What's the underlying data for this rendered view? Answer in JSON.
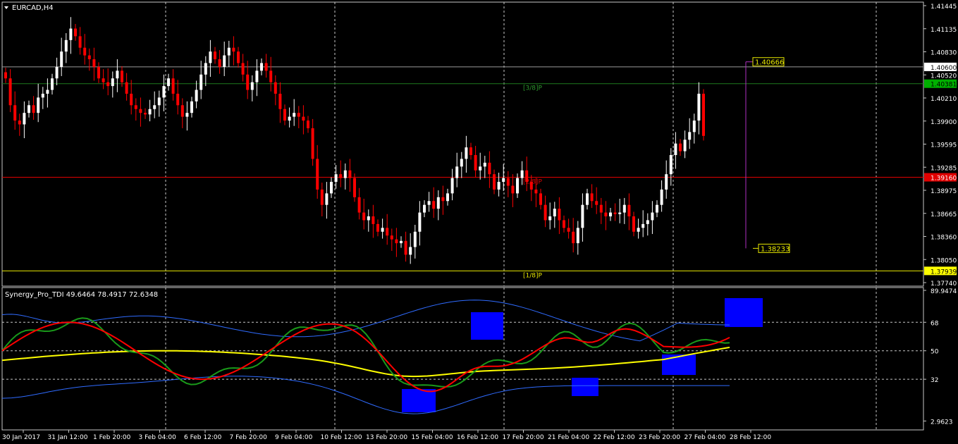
{
  "symbol": "EURCAD,H4",
  "indicator": "Synergy_Pro_TDI 49.6464 78.4917 72.6348",
  "price_axis": {
    "range": [
      1.3774,
      1.41445
    ],
    "ticks": [
      "1.41445",
      "1.41135",
      "1.40830",
      "1.40520",
      "1.40210",
      "1.39900",
      "1.39595",
      "1.39285",
      "1.38975",
      "1.38665",
      "1.38360",
      "1.38050",
      "1.37740"
    ]
  },
  "price_tags": [
    {
      "value": "1.40600",
      "bg": "#ffffff",
      "fg": "#000000"
    },
    {
      "value": "1.40381",
      "bg": "#00b000",
      "fg": "#000000"
    },
    {
      "value": "1.39160",
      "bg": "#e00000",
      "fg": "#ffffff"
    },
    {
      "value": "1.37939",
      "bg": "#ffff00",
      "fg": "#000000"
    }
  ],
  "horizontal_lines": [
    {
      "price": 1.406,
      "color": "#9a9a9a",
      "label": ""
    },
    {
      "price": 1.40381,
      "color": "#1e7a1e",
      "label": "[3/8]P",
      "label_color": "#2e9a2e"
    },
    {
      "price": 1.3916,
      "color": "#e00000",
      "label": "[2/8]P",
      "label_color": "#e00000"
    },
    {
      "price": 1.37939,
      "color": "#e8e800",
      "label": "[1/8]P",
      "label_color": "#e8e800"
    }
  ],
  "measure": {
    "top_label": "1.40666",
    "bottom_label": "1.38233",
    "top": 1.40666,
    "bottom": 1.38233,
    "color": "#b030c0"
  },
  "time_labels": [
    "30 Jan 2017",
    "31 Jan 12:00",
    "1 Feb 20:00",
    "3 Feb 04:00",
    "6 Feb 12:00",
    "7 Feb 20:00",
    "9 Feb 04:00",
    "10 Feb 12:00",
    "13 Feb 20:00",
    "15 Feb 04:00",
    "16 Feb 12:00",
    "17 Feb 20:00",
    "21 Feb 04:00",
    "22 Feb 12:00",
    "23 Feb 20:00",
    "27 Feb 04:00",
    "28 Feb 12:00"
  ],
  "indicator_axis": {
    "range": [
      0,
      89.9474
    ],
    "ticks": [
      "89.9474",
      "68",
      "50",
      "32",
      "2.9623"
    ],
    "levels": [
      68,
      50,
      32
    ]
  },
  "colors": {
    "bull": "#ffffff",
    "bear": "#ff0000",
    "rsi": "#ff0000",
    "signal": "#1a9a1a",
    "mid": "#ffff00",
    "bands": "#2f6bff",
    "box": "#0000ff",
    "grid": "#c8c8c8"
  },
  "chart_data": {
    "type": "candlestick",
    "closes": [
      1.4045,
      1.401,
      1.399,
      1.3985,
      1.4,
      1.401,
      1.4,
      1.402,
      1.4025,
      1.403,
      1.4045,
      1.406,
      1.408,
      1.4095,
      1.411,
      1.41,
      1.4085,
      1.4075,
      1.407,
      1.406,
      1.4045,
      1.404,
      1.4035,
      1.4045,
      1.4055,
      1.404,
      1.4025,
      1.401,
      1.4005,
      1.4,
      1.3998,
      1.4005,
      1.401,
      1.402,
      1.4035,
      1.4045,
      1.4025,
      1.401,
      1.3995,
      1.4,
      1.4015,
      1.403,
      1.405,
      1.4065,
      1.408,
      1.407,
      1.406,
      1.4075,
      1.4085,
      1.408,
      1.4065,
      1.405,
      1.403,
      1.404,
      1.4055,
      1.4065,
      1.4055,
      1.404,
      1.4025,
      1.4005,
      1.399,
      1.3995,
      1.4,
      1.3995,
      1.399,
      1.398,
      1.394,
      1.39,
      1.388,
      1.3895,
      1.391,
      1.392,
      1.3915,
      1.3925,
      1.3915,
      1.389,
      1.387,
      1.386,
      1.3865,
      1.3855,
      1.3845,
      1.385,
      1.384,
      1.3835,
      1.383,
      1.3833,
      1.3815,
      1.3825,
      1.3845,
      1.387,
      1.388,
      1.3885,
      1.3875,
      1.389,
      1.3885,
      1.3895,
      1.3915,
      1.393,
      1.394,
      1.3955,
      1.3945,
      1.3925,
      1.393,
      1.3935,
      1.392,
      1.39,
      1.391,
      1.3915,
      1.3905,
      1.3895,
      1.3915,
      1.3925,
      1.391,
      1.39,
      1.3895,
      1.388,
      1.386,
      1.3865,
      1.3875,
      1.386,
      1.385,
      1.3845,
      1.383,
      1.385,
      1.388,
      1.3895,
      1.3885,
      1.388,
      1.387,
      1.3865,
      1.387,
      1.3868,
      1.387,
      1.388,
      1.3865,
      1.3845,
      1.385,
      1.3855,
      1.386,
      1.387,
      1.388,
      1.39,
      1.392,
      1.3945,
      1.396,
      1.395,
      1.3965,
      1.3975,
      1.399,
      1.4025,
      1.397
    ]
  }
}
